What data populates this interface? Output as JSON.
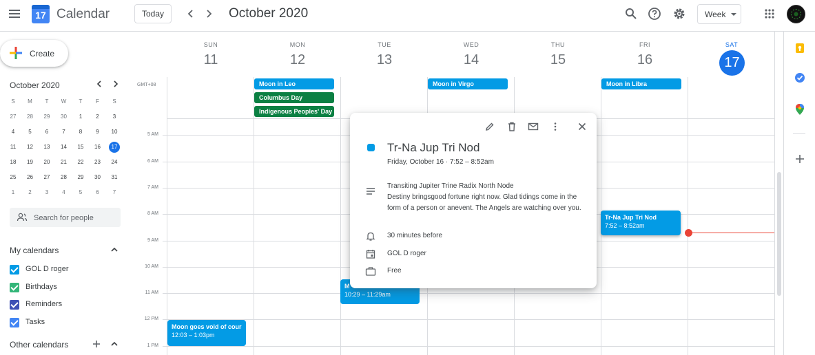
{
  "header": {
    "app_title": "Calendar",
    "logo_day": "17",
    "today_label": "Today",
    "month_title": "October 2020",
    "view_label": "Week",
    "icons": [
      "menu-icon",
      "search-icon",
      "help-icon",
      "settings-icon",
      "apps-grid-icon"
    ]
  },
  "sidebar": {
    "create_label": "Create",
    "mini_month": "October 2020",
    "weekday_heads": [
      "S",
      "M",
      "T",
      "W",
      "T",
      "F",
      "S"
    ],
    "weeks": [
      [
        "27",
        "28",
        "29",
        "30",
        "1",
        "2",
        "3"
      ],
      [
        "4",
        "5",
        "6",
        "7",
        "8",
        "9",
        "10"
      ],
      [
        "11",
        "12",
        "13",
        "14",
        "15",
        "16",
        "17"
      ],
      [
        "18",
        "19",
        "20",
        "21",
        "22",
        "23",
        "24"
      ],
      [
        "25",
        "26",
        "27",
        "28",
        "29",
        "30",
        "31"
      ],
      [
        "1",
        "2",
        "3",
        "4",
        "5",
        "6",
        "7"
      ]
    ],
    "selected_day": "17",
    "search_placeholder": "Search for people",
    "my_calendars_title": "My calendars",
    "my_calendars": [
      {
        "label": "GOL D roger",
        "color": "#039be5"
      },
      {
        "label": "Birthdays",
        "color": "#33b679"
      },
      {
        "label": "Reminders",
        "color": "#3f51b5"
      },
      {
        "label": "Tasks",
        "color": "#4285f4"
      }
    ],
    "other_calendars_title": "Other calendars"
  },
  "week": {
    "timezone": "GMT+08",
    "days": [
      {
        "name": "SUN",
        "num": "11"
      },
      {
        "name": "MON",
        "num": "12"
      },
      {
        "name": "TUE",
        "num": "13"
      },
      {
        "name": "WED",
        "num": "14"
      },
      {
        "name": "THU",
        "num": "15"
      },
      {
        "name": "FRI",
        "num": "16"
      },
      {
        "name": "SAT",
        "num": "17"
      }
    ],
    "hours": [
      "5 AM",
      "6 AM",
      "7 AM",
      "8 AM",
      "9 AM",
      "10 AM",
      "11 AM",
      "12 PM",
      "1 PM"
    ],
    "allday_events": [
      {
        "label": "Moon in Leo",
        "color": "#039be5"
      },
      {
        "label": "Columbus Day",
        "color": "#0b8043"
      },
      {
        "label": "Indigenous Peoples' Day",
        "color": "#0b8043"
      },
      {
        "label": "Moon in Virgo",
        "color": "#039be5"
      },
      {
        "label": "Moon in Libra",
        "color": "#039be5"
      }
    ],
    "events": [
      {
        "title": "Moon goes void of cours",
        "time": "12:03 – 1:03pm"
      },
      {
        "title": "M",
        "time": "10:29 – 11:29am"
      },
      {
        "title": "Tr-Na Jup Tri Nod",
        "time": "7:52 – 8:52am"
      }
    ]
  },
  "popup": {
    "title": "Tr-Na Jup Tri Nod",
    "when": "Friday, October 16  ·  7:52 – 8:52am",
    "desc_line1": "Transiting Jupiter Trine Radix North Node",
    "desc_line2": "Destiny bringsgood fortune right now. Glad tidings come in the form of a person or anevent. The Angels are watching over you.",
    "reminder": "30 minutes before",
    "calendar": "GOL D roger",
    "availability": "Free",
    "event_color": "#039be5"
  },
  "colors": {
    "accent": "#1a73e8",
    "now_line": "#ea4335"
  }
}
